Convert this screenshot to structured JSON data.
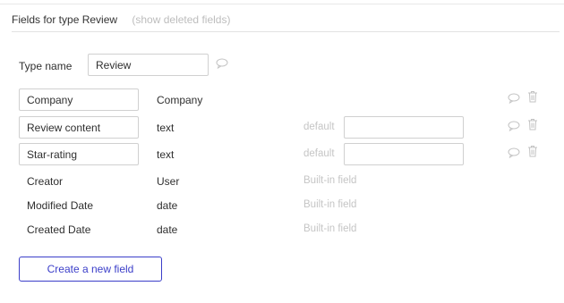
{
  "header": {
    "title": "Fields for type Review",
    "show_deleted": "(show deleted fields)"
  },
  "type_name": {
    "label": "Type name",
    "value": "Review"
  },
  "fields": [
    {
      "name": "Company",
      "type": "Company"
    },
    {
      "name": "Review content",
      "type": "text",
      "default_label": "default",
      "default_value": ""
    },
    {
      "name": "Star-rating",
      "type": "text",
      "default_label": "default",
      "default_value": ""
    }
  ],
  "builtin_fields": [
    {
      "name": "Creator",
      "type": "User",
      "note": "Built-in field"
    },
    {
      "name": "Modified Date",
      "type": "date",
      "note": "Built-in field"
    },
    {
      "name": "Created Date",
      "type": "date",
      "note": "Built-in field"
    }
  ],
  "create_button": {
    "label": "Create a new field"
  },
  "icons": {
    "comment": "comment-icon",
    "delete": "trash-icon"
  },
  "colors": {
    "accent": "#3b3ec9",
    "muted_text": "#c5c5c5",
    "border": "#d0d0d0"
  }
}
